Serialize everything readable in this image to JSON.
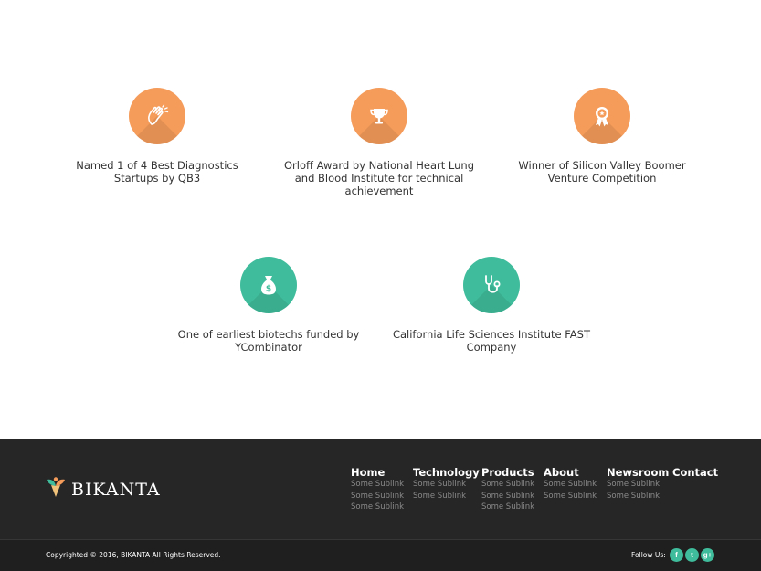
{
  "awards": [
    {
      "icon": "clapping-hands-icon",
      "color": "#f59c5b",
      "caption": "Named 1 of 4 Best Diagnostics Startups by QB3"
    },
    {
      "icon": "trophy-icon",
      "color": "#f59c5b",
      "caption": "Orloff Award by National Heart Lung and Blood Institute for technical achievement"
    },
    {
      "icon": "award-ribbon-icon",
      "color": "#f59c5b",
      "caption": "Winner of Silicon Valley Boomer Venture Competition"
    },
    {
      "icon": "money-bag-icon",
      "color": "#3fbc9b",
      "caption": "One of earliest biotechs funded by YCombinator"
    },
    {
      "icon": "stethoscope-icon",
      "color": "#3fbc9b",
      "caption": "California Life Sciences Institute FAST Company"
    }
  ],
  "footer": {
    "logo_text": "BIKANTA",
    "nav": [
      {
        "title": "Home",
        "sublinks": [
          "Some Sublink",
          "Some Sublink",
          "Some Sublink"
        ]
      },
      {
        "title": "Technology",
        "sublinks": [
          "Some Sublink",
          "Some Sublink"
        ]
      },
      {
        "title": "Products",
        "sublinks": [
          "Some Sublink",
          "Some Sublink",
          "Some Sublink"
        ]
      },
      {
        "title": "About",
        "sublinks": [
          "Some Sublink",
          "Some Sublink"
        ]
      },
      {
        "title": "Newsroom",
        "sublinks": [
          "Some Sublink",
          "Some Sublink"
        ]
      },
      {
        "title": "Contact",
        "sublinks": []
      }
    ],
    "copyright": "Copyrighted © 2016, BIKANTA All Rights Reserved.",
    "follow_label": "Follow Us:",
    "social": [
      {
        "icon": "facebook-icon",
        "glyph": "f"
      },
      {
        "icon": "twitter-icon",
        "glyph": "t"
      },
      {
        "icon": "google-plus-icon",
        "glyph": "g+"
      }
    ],
    "accent": "#3fbc9b"
  }
}
